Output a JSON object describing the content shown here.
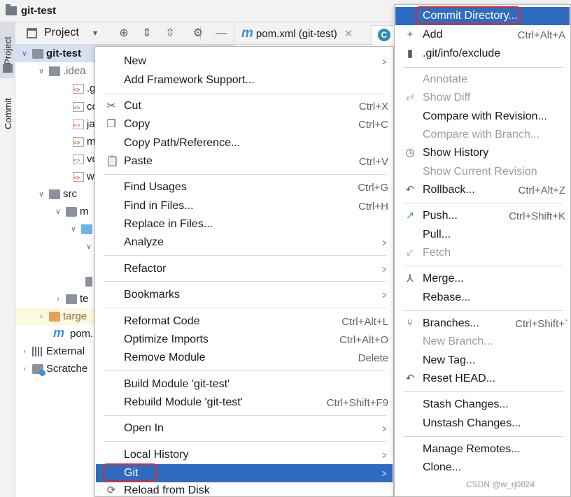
{
  "window": {
    "title": "git-test"
  },
  "side_tabs": {
    "project": "Project",
    "commit": "Commit"
  },
  "project_toolbar": {
    "view_label": "Project"
  },
  "editor_tabs": [
    {
      "label": "pom.xml (git-test)"
    }
  ],
  "tree": [
    {
      "label": "git-test",
      "icon": "module-folder-icon",
      "arrow": "down",
      "bold": true
    },
    {
      "label": ".idea",
      "icon": "folder-icon",
      "arrow": "down"
    },
    {
      "label": ".g",
      "icon": "gitignore-file-icon"
    },
    {
      "label": "co",
      "icon": "xml-file-icon"
    },
    {
      "label": "jar",
      "icon": "xml-file-icon"
    },
    {
      "label": "m",
      "icon": "xml-file-icon"
    },
    {
      "label": "vc",
      "icon": "xml-file-icon"
    },
    {
      "label": "w",
      "icon": "xml-file-icon"
    },
    {
      "label": "src",
      "icon": "folder-icon",
      "arrow": "down"
    },
    {
      "label": "m",
      "icon": "folder-icon",
      "arrow": "down"
    },
    {
      "label": "",
      "icon": "source-folder-icon",
      "arrow": "down"
    },
    {
      "label": "",
      "icon": "",
      "arrow": "down"
    },
    {
      "label": "",
      "icon": ""
    },
    {
      "label": "",
      "icon": "folder-icon"
    },
    {
      "label": "te",
      "icon": "folder-icon",
      "arrow": "right"
    },
    {
      "label": "targe",
      "icon": "excluded-folder-icon",
      "arrow": "right"
    },
    {
      "label": "pom.",
      "icon": "maven-file-icon"
    },
    {
      "label": "External",
      "icon": "library-icon",
      "arrow": "right"
    },
    {
      "label": "Scratche",
      "icon": "scratch-icon",
      "arrow": "right"
    }
  ],
  "context_menu": [
    {
      "label": "New",
      "submenu": true
    },
    {
      "label": "Add Framework Support..."
    },
    {
      "sep": true
    },
    {
      "label": "Cut",
      "shortcut": "Ctrl+X",
      "icon": "scissors-icon"
    },
    {
      "label": "Copy",
      "shortcut": "Ctrl+C",
      "icon": "copy-icon"
    },
    {
      "label": "Copy Path/Reference..."
    },
    {
      "label": "Paste",
      "shortcut": "Ctrl+V",
      "icon": "paste-icon"
    },
    {
      "sep": true
    },
    {
      "label": "Find Usages",
      "shortcut": "Ctrl+G"
    },
    {
      "label": "Find in Files...",
      "shortcut": "Ctrl+H"
    },
    {
      "label": "Replace in Files..."
    },
    {
      "label": "Analyze",
      "submenu": true
    },
    {
      "sep": true
    },
    {
      "label": "Refactor",
      "submenu": true
    },
    {
      "sep": true
    },
    {
      "label": "Bookmarks",
      "submenu": true
    },
    {
      "sep": true
    },
    {
      "label": "Reformat Code",
      "shortcut": "Ctrl+Alt+L"
    },
    {
      "label": "Optimize Imports",
      "shortcut": "Ctrl+Alt+O"
    },
    {
      "label": "Remove Module",
      "shortcut": "Delete"
    },
    {
      "sep": true
    },
    {
      "label": "Build Module 'git-test'"
    },
    {
      "label": "Rebuild Module 'git-test'",
      "shortcut": "Ctrl+Shift+F9"
    },
    {
      "sep": true
    },
    {
      "label": "Open In",
      "submenu": true
    },
    {
      "sep": true
    },
    {
      "label": "Local History",
      "submenu": true
    },
    {
      "label": "Git",
      "submenu": true,
      "highlighted": true
    },
    {
      "label": "Reload from Disk",
      "icon": "reload-icon"
    }
  ],
  "git_submenu": [
    {
      "label": "Commit Directory...",
      "highlighted": true
    },
    {
      "label": "Add",
      "shortcut": "Ctrl+Alt+A",
      "icon": "plus-icon"
    },
    {
      "label": ".git/info/exclude",
      "icon": "git-exclude-icon"
    },
    {
      "sep": true
    },
    {
      "label": "Annotate",
      "disabled": true
    },
    {
      "label": "Show Diff",
      "disabled": true,
      "icon": "diff-icon"
    },
    {
      "label": "Compare with Revision..."
    },
    {
      "label": "Compare with Branch...",
      "disabled": true
    },
    {
      "label": "Show History",
      "icon": "history-icon"
    },
    {
      "label": "Show Current Revision",
      "disabled": true
    },
    {
      "label": "Rollback...",
      "shortcut": "Ctrl+Alt+Z",
      "icon": "rollback-icon"
    },
    {
      "sep": true
    },
    {
      "label": "Push...",
      "shortcut": "Ctrl+Shift+K",
      "icon": "push-icon"
    },
    {
      "label": "Pull..."
    },
    {
      "label": "Fetch",
      "disabled": true,
      "icon": "fetch-icon"
    },
    {
      "sep": true
    },
    {
      "label": "Merge...",
      "icon": "merge-icon"
    },
    {
      "label": "Rebase..."
    },
    {
      "sep": true
    },
    {
      "label": "Branches...",
      "shortcut": "Ctrl+Shift+`",
      "icon": "branch-icon"
    },
    {
      "label": "New Branch...",
      "disabled": true
    },
    {
      "label": "New Tag..."
    },
    {
      "label": "Reset HEAD...",
      "icon": "reset-icon"
    },
    {
      "sep": true
    },
    {
      "label": "Stash Changes..."
    },
    {
      "label": "Unstash Changes..."
    },
    {
      "sep": true
    },
    {
      "label": "Manage Remotes..."
    },
    {
      "label": "Clone..."
    }
  ],
  "watermark": "CSDN @w_rj0824",
  "colors": {
    "highlight": "#2e6cc3",
    "callout": "#e02a2a",
    "selection": "#d5e1f2",
    "maven": "#3d8fd6"
  }
}
